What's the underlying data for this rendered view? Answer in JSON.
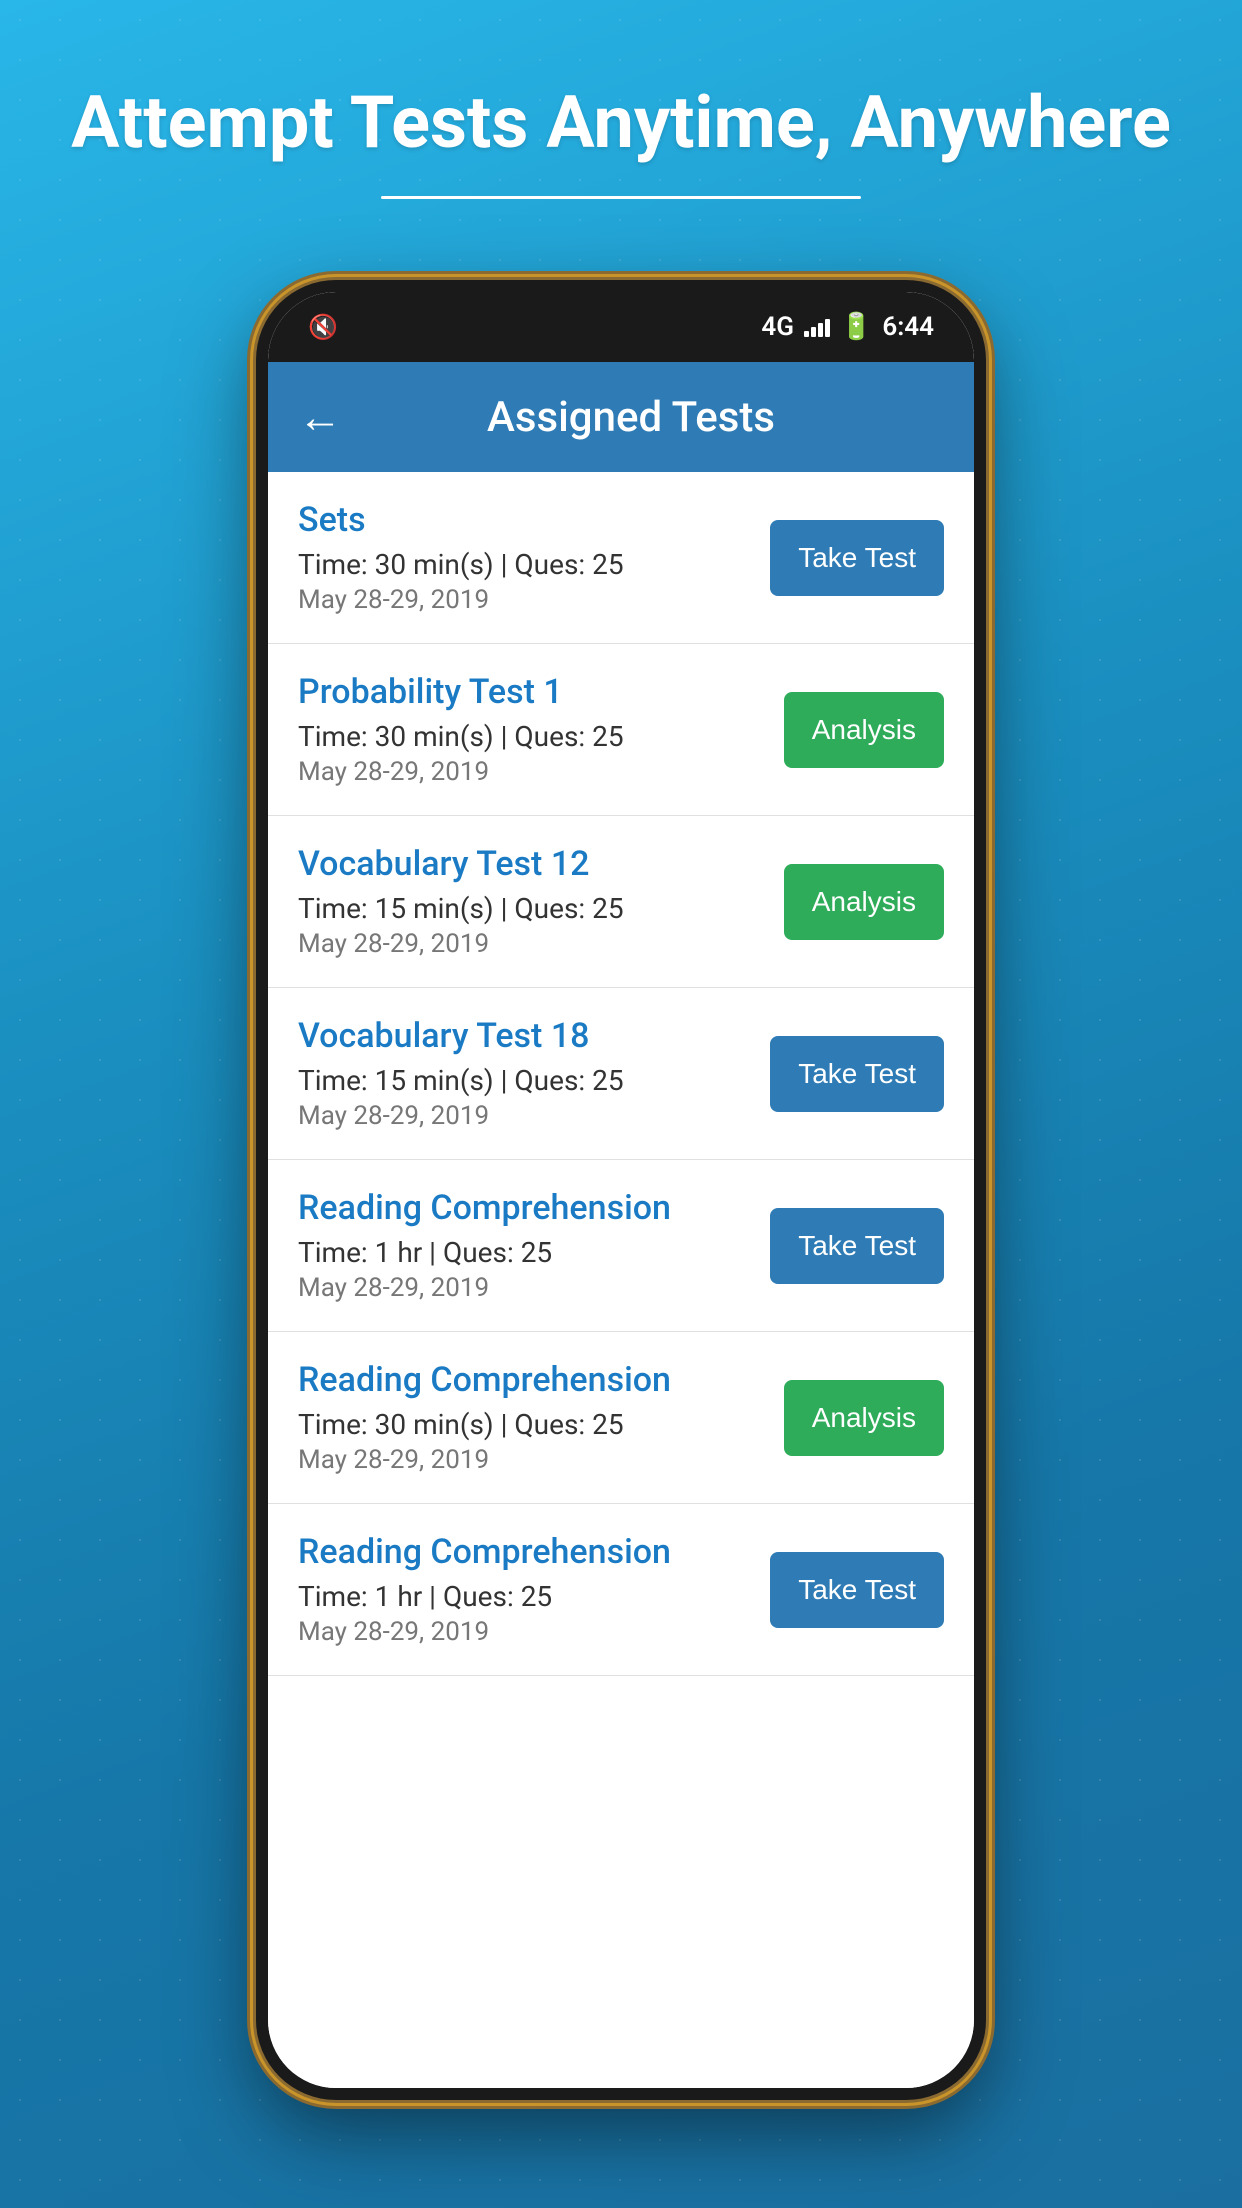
{
  "page": {
    "headline": "Attempt Tests Anytime, Anywhere",
    "appBar": {
      "title": "Assigned Tests",
      "back_label": "←"
    },
    "statusBar": {
      "network": "4G",
      "time": "6:44"
    },
    "tests": [
      {
        "id": 1,
        "name": "Sets",
        "time": "Time: 30 min(s) | Ques: 25",
        "date": "May 28-29, 2019",
        "button": "Take Test",
        "button_type": "take"
      },
      {
        "id": 2,
        "name": "Probability Test 1",
        "time": "Time: 30 min(s) | Ques: 25",
        "date": "May 28-29, 2019",
        "button": "Analysis",
        "button_type": "analysis"
      },
      {
        "id": 3,
        "name": "Vocabulary Test 12",
        "time": "Time: 15 min(s) | Ques: 25",
        "date": "May 28-29, 2019",
        "button": "Analysis",
        "button_type": "analysis"
      },
      {
        "id": 4,
        "name": "Vocabulary Test 18",
        "time": "Time: 15 min(s) | Ques: 25",
        "date": "May 28-29, 2019",
        "button": "Take Test",
        "button_type": "take"
      },
      {
        "id": 5,
        "name": "Reading Comprehension",
        "time": "Time: 1 hr | Ques: 25",
        "date": "May 28-29, 2019",
        "button": "Take Test",
        "button_type": "take"
      },
      {
        "id": 6,
        "name": "Reading Comprehension",
        "time": "Time: 30 min(s) | Ques: 25",
        "date": "May 28-29, 2019",
        "button": "Analysis",
        "button_type": "analysis"
      },
      {
        "id": 7,
        "name": "Reading Comprehension",
        "time": "Time: 1 hr | Ques: 25",
        "date": "May 28-29, 2019",
        "button": "Take Test",
        "button_type": "take"
      }
    ]
  }
}
